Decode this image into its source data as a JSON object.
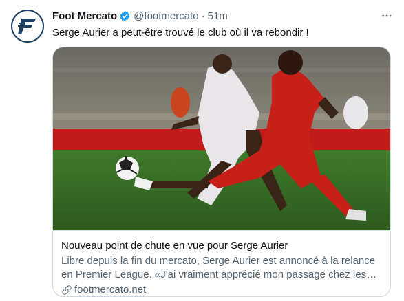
{
  "tweet": {
    "author_name": "Foot Mercato",
    "handle": "@footmercato",
    "separator": "·",
    "time": "51m",
    "text": "Serge Aurier a peut-être trouvé le club où il va rebondir !"
  },
  "card": {
    "title": "Nouveau point de chute en vue pour Serge Aurier",
    "description": "Libre depuis la fin du mercato, Serge Aurier est annoncé à la relance en Premier League. «J'ai vraiment apprécié mon passage chez les Spurs e...",
    "domain": "footmercato.net"
  },
  "colors": {
    "verified": "#1d9bf0",
    "secondary_text": "#536471",
    "border": "#cfd9de",
    "logo_blue": "#1c3f63"
  },
  "icons": {
    "avatar": "foot-mercato-logo",
    "verified": "verified-badge-icon",
    "more": "more-options-icon",
    "link": "link-icon"
  }
}
